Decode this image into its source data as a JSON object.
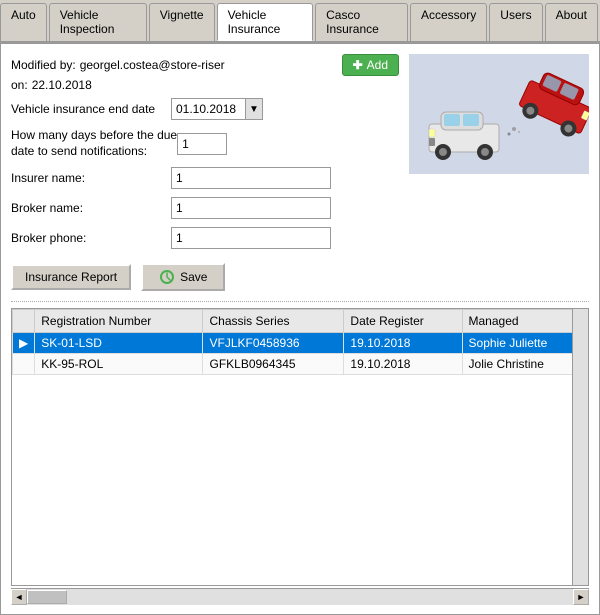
{
  "tabs": [
    {
      "id": "auto",
      "label": "Auto",
      "active": false
    },
    {
      "id": "vehicle-inspection",
      "label": "Vehicle Inspection",
      "active": false
    },
    {
      "id": "vignette",
      "label": "Vignette",
      "active": false
    },
    {
      "id": "vehicle-insurance",
      "label": "Vehicle Insurance",
      "active": true
    },
    {
      "id": "casco-insurance",
      "label": "Casco Insurance",
      "active": false
    },
    {
      "id": "accessory",
      "label": "Accessory",
      "active": false
    },
    {
      "id": "users",
      "label": "Users",
      "active": false
    },
    {
      "id": "about",
      "label": "About",
      "active": false
    }
  ],
  "form": {
    "modified_by_label": "Modified by:",
    "modified_by_value": "georgel.costea@store-riser",
    "add_label": "Add",
    "on_label": "on:",
    "on_value": "22.10.2018",
    "end_date_label": "Vehicle insurance end date",
    "end_date_value": "01.10.2018",
    "days_label": "How many days before the due\ndate to send notifications:",
    "days_value": "1",
    "insurer_label": "Insurer name:",
    "insurer_value": "1",
    "broker_label": "Broker name:",
    "broker_value": "1",
    "phone_label": "Broker phone:",
    "phone_value": "1"
  },
  "buttons": {
    "report_label": "Insurance Report",
    "save_label": "Save"
  },
  "table": {
    "columns": [
      "",
      "Registration Number",
      "Chassis Series",
      "Date Register",
      "Managed"
    ],
    "rows": [
      {
        "indicator": "▶",
        "registration": "SK-01-LSD",
        "chassis": "VFJLKF0458936",
        "date": "19.10.2018",
        "managed": "Sophie Juliette",
        "selected": true
      },
      {
        "indicator": "",
        "registration": "KK-95-ROL",
        "chassis": "GFKLB0964345",
        "date": "19.10.2018",
        "managed": "Jolie Christine",
        "selected": false
      }
    ]
  },
  "icons": {
    "add_plus": "+",
    "save_arrow": "↺",
    "dropdown_arrow": "▼",
    "scroll_left": "◄",
    "scroll_right": "►",
    "sort_up": "▲"
  }
}
